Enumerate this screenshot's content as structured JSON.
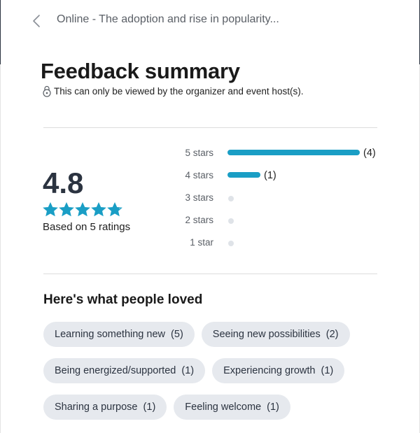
{
  "header": {
    "back_icon": "chevron-left-icon",
    "event_title": "Online - The adoption and rise in popularity..."
  },
  "page": {
    "title": "Feedback summary",
    "privacy_icon": "lock-icon",
    "privacy_note": "This can only be viewed by the organizer and event host(s)."
  },
  "rating": {
    "average": "4.8",
    "stars_value": 4.8,
    "stars_max": 5,
    "based_on": "Based on 5 ratings",
    "accent_color": "#1a9ec5",
    "distribution": [
      {
        "label": "5 stars",
        "count": 4,
        "count_text": "(4)"
      },
      {
        "label": "4 stars",
        "count": 1,
        "count_text": "(1)"
      },
      {
        "label": "3 stars",
        "count": 0,
        "count_text": ""
      },
      {
        "label": "2 stars",
        "count": 0,
        "count_text": ""
      },
      {
        "label": "1 star",
        "count": 0,
        "count_text": ""
      }
    ]
  },
  "loved": {
    "title": "Here's what people loved",
    "chips": [
      [
        "Learning something new  (5)",
        "Seeing new possibilities  (2)"
      ],
      [
        "Being energized/supported  (1)",
        "Experiencing growth  (1)"
      ],
      [
        "Sharing a purpose  (1)",
        "Feeling welcome  (1)"
      ]
    ]
  }
}
